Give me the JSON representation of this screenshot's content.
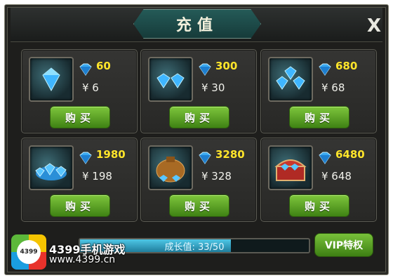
{
  "dialog": {
    "title": "充值",
    "close_label": "X"
  },
  "packs": [
    {
      "amount": "60",
      "price": "¥  6",
      "buy_label": "购买",
      "icon": "single-diamond-icon"
    },
    {
      "amount": "300",
      "price": "¥  30",
      "buy_label": "购买",
      "icon": "two-diamonds-icon"
    },
    {
      "amount": "680",
      "price": "¥  68",
      "buy_label": "购买",
      "icon": "diamond-pile-icon"
    },
    {
      "amount": "1980",
      "price": "¥  198",
      "buy_label": "购买",
      "icon": "diamond-heap-icon"
    },
    {
      "amount": "3280",
      "price": "¥  328",
      "buy_label": "购买",
      "icon": "diamond-sack-icon"
    },
    {
      "amount": "6480",
      "price": "¥  648",
      "buy_label": "购买",
      "icon": "diamond-chest-icon"
    }
  ],
  "growth": {
    "label": "成长值: 33/50",
    "current": 33,
    "max": 50
  },
  "vip_button_label": "VIP特权",
  "watermark": {
    "logo_text": "4399",
    "name": "4399手机游戏",
    "url": "www.4399.cn"
  },
  "colors": {
    "accent_gold": "#ffe52a",
    "button_green": "#5fa528",
    "progress_blue": "#34a6c6"
  }
}
